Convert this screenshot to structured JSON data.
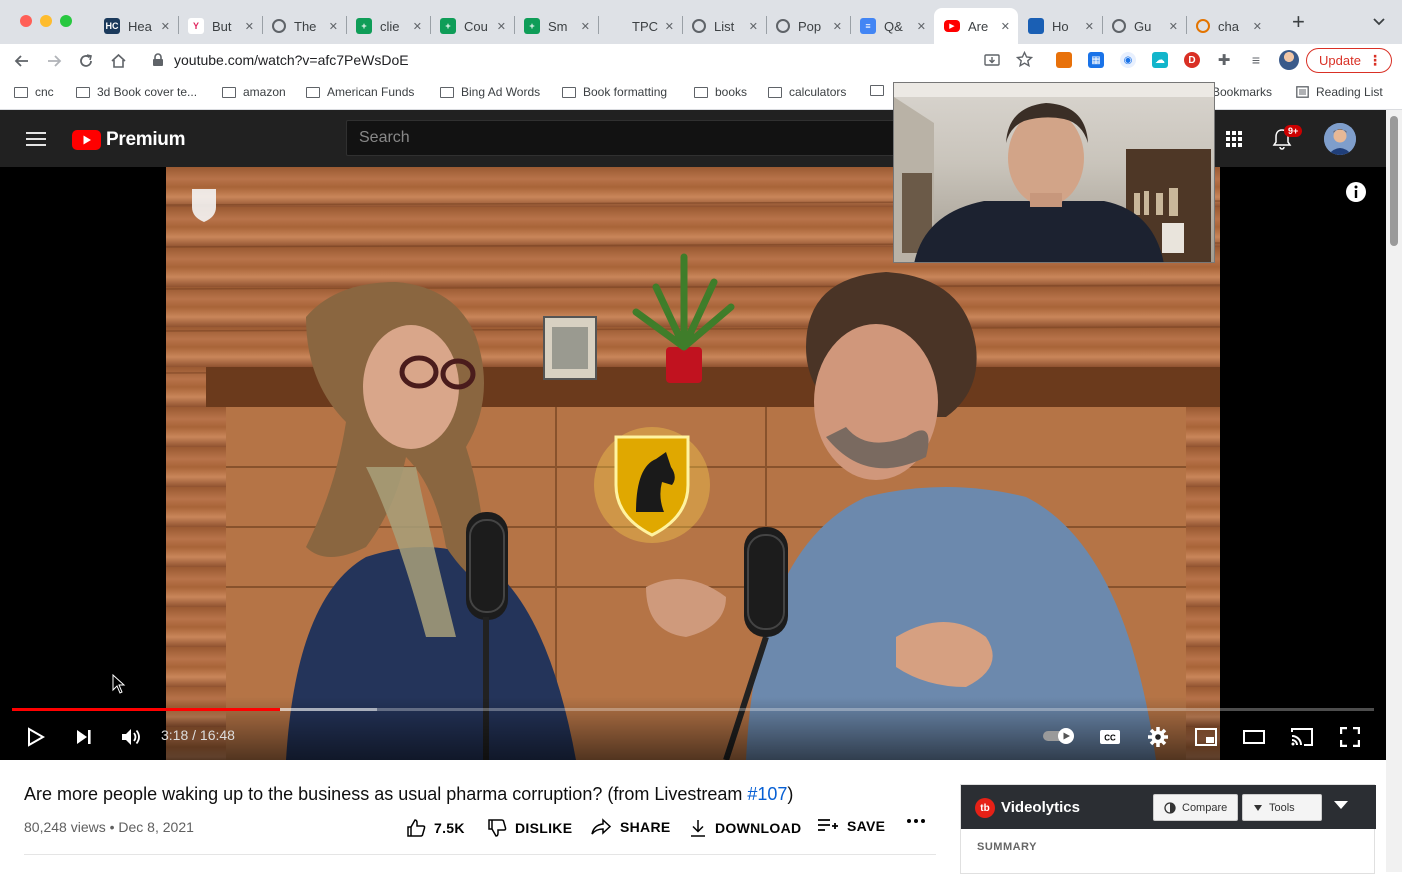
{
  "window": {
    "traffic_lights": [
      "#ff5f57",
      "#febc2e",
      "#28c840"
    ]
  },
  "tabs": [
    {
      "label": "Hea",
      "icon": "hc-favicon",
      "icon_text": "HC",
      "color": "#1b3a5c"
    },
    {
      "label": "But",
      "icon": "y-favicon",
      "icon_text": "Y",
      "color": "#ffffff"
    },
    {
      "label": "The",
      "icon": "globe-icon",
      "icon_text": "",
      "color": "#5f6368"
    },
    {
      "label": "clie",
      "icon": "sheets-icon",
      "icon_text": "+",
      "color": "#0f9d58"
    },
    {
      "label": "Cou",
      "icon": "sheets-icon",
      "icon_text": "+",
      "color": "#0f9d58"
    },
    {
      "label": "Sm",
      "icon": "sheets-icon",
      "icon_text": "+",
      "color": "#0f9d58"
    },
    {
      "label": "TPC",
      "icon": "",
      "icon_text": "",
      "color": ""
    },
    {
      "label": "List",
      "icon": "globe-icon",
      "icon_text": "",
      "color": "#5f6368"
    },
    {
      "label": "Pop",
      "icon": "globe-icon",
      "icon_text": "",
      "color": "#5f6368"
    },
    {
      "label": "Q&",
      "icon": "docs-icon",
      "icon_text": "≡",
      "color": "#4285f4"
    },
    {
      "label": "Are",
      "icon": "youtube-icon",
      "icon_text": "▶",
      "color": "#ff0000",
      "active": true
    },
    {
      "label": "Ho",
      "icon": "hex-icon",
      "icon_text": "",
      "color": "#1a5fb4"
    },
    {
      "label": "Gu",
      "icon": "globe-icon",
      "icon_text": "",
      "color": "#5f6368"
    },
    {
      "label": "cha",
      "icon": "openai-icon",
      "icon_text": "",
      "color": "#e37400"
    }
  ],
  "toolbar": {
    "url": "youtube.com/watch?v=afc7PeWsDoE",
    "update_label": "Update"
  },
  "bookmarks": [
    "cnc",
    "3d Book cover te...",
    "amazon",
    "American Funds",
    "Bing Ad Words",
    "Book formatting",
    "books",
    "calculators"
  ],
  "bookmarks_right": {
    "other": "Bookmarks",
    "reading_list": "Reading List"
  },
  "youtube": {
    "logo_label": "Premium",
    "search_placeholder": "Search",
    "notification_badge": "9+"
  },
  "player": {
    "time": "3:18 / 16:48",
    "progress_played": 0.197,
    "progress_buffered": 0.268
  },
  "video": {
    "title_prefix": "Are more people waking up to the business as usual pharma corruption? (from Livestream ",
    "title_hashtag": "#107",
    "title_suffix": ")",
    "views_line": "80,248 views • Dec 8, 2021",
    "like_count": "7.5K",
    "dislike_label": "DISLIKE",
    "share_label": "SHARE",
    "download_label": "DOWNLOAD",
    "save_label": "SAVE"
  },
  "videolytics": {
    "title": "Videolytics",
    "compare_label": "Compare",
    "tools_label": "Tools",
    "summary_label": "SUMMARY"
  }
}
